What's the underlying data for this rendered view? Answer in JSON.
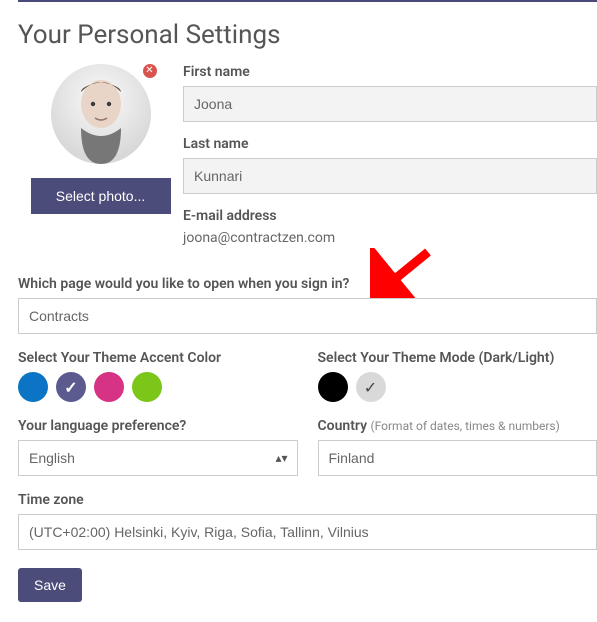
{
  "title": "Your Personal Settings",
  "photo": {
    "button": "Select photo..."
  },
  "fields": {
    "first_name": {
      "label": "First name",
      "value": "Joona"
    },
    "last_name": {
      "label": "Last name",
      "value": "Kunnari"
    },
    "email": {
      "label": "E-mail address",
      "value": "joona@contractzen.com"
    },
    "landing_page": {
      "label": "Which page would you like to open when you sign in?",
      "value": "Contracts"
    },
    "language": {
      "label": "Your language preference?",
      "value": "English"
    },
    "country": {
      "label": "Country",
      "hint": "(Format of dates, times & numbers)",
      "value": "Finland"
    },
    "timezone": {
      "label": "Time zone",
      "value": "(UTC+02:00) Helsinki, Kyiv, Riga, Sofia, Tallinn, Vilnius"
    }
  },
  "theme": {
    "accent": {
      "label": "Select Your Theme Accent Color",
      "options": [
        {
          "name": "blue",
          "color": "#0b74c4",
          "selected": false
        },
        {
          "name": "purple",
          "color": "#5b5b8f",
          "selected": true
        },
        {
          "name": "pink",
          "color": "#d63384",
          "selected": false
        },
        {
          "name": "green",
          "color": "#7cc61a",
          "selected": false
        }
      ]
    },
    "mode": {
      "label": "Select Your Theme Mode (Dark/Light)",
      "options": [
        {
          "name": "dark",
          "color": "#000000",
          "selected": false
        },
        {
          "name": "light",
          "color": "#d9d9d9",
          "selected": true
        }
      ]
    }
  },
  "save_button": "Save"
}
